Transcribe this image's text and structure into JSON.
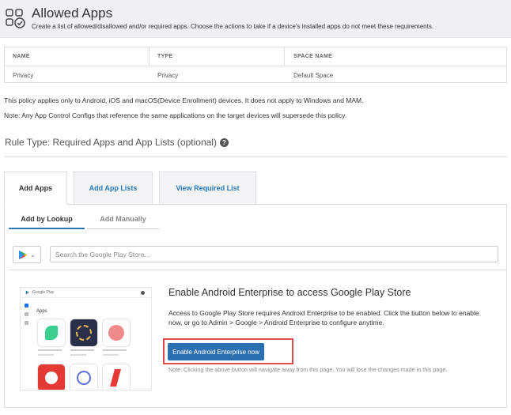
{
  "header": {
    "title": "Allowed Apps",
    "subtitle": "Create a list of allowed/disallowed and/or required apps. Choose the actions to take if a device's installed apps do not meet these requirements.",
    "icon": "apps-check-icon"
  },
  "table": {
    "headers": [
      "NAME",
      "TYPE",
      "SPACE NAME"
    ],
    "rows": [
      [
        "Privacy",
        "Privacy",
        "Default Space"
      ]
    ]
  },
  "notes": {
    "line1": "This policy applies only to Android, iOS and macOS(Device Enrollment) devices. It does not apply to Windows and MAM.",
    "line2": "Note: Any App Control Configs that reference the same applications on the target devices will supersede this policy."
  },
  "rule_type": {
    "label": "Rule Type: Required Apps and App Lists (optional)",
    "help_icon": "?"
  },
  "tabs": [
    {
      "label": "Add Apps",
      "active": true
    },
    {
      "label": "Add App Lists",
      "active": false
    },
    {
      "label": "View Required List",
      "active": false
    }
  ],
  "subtabs": [
    {
      "label": "Add by Lookup",
      "active": true
    },
    {
      "label": "Add Manually",
      "active": false
    }
  ],
  "search": {
    "store_icon": "google-play-icon",
    "placeholder": "Search the Google Play Store..."
  },
  "mockup": {
    "brand": "Google Play",
    "section": "Apps"
  },
  "enterprise": {
    "title": "Enable Android Enterprise to access Google Play Store",
    "description": "Access to Google Play Store requires Android Enterprise to be enabled. Click the button below to enable now, or go to Admin > Google > Android Enterprise to configure anytime.",
    "button_label": "Enable Android Enterprise now",
    "note": "Note: Clicking the above button will navigate away from this page. You will lose the changes made in this page."
  },
  "colors": {
    "accent": "#2a7ab8",
    "button": "#2a6fb0",
    "highlight": "#e04a4a"
  }
}
